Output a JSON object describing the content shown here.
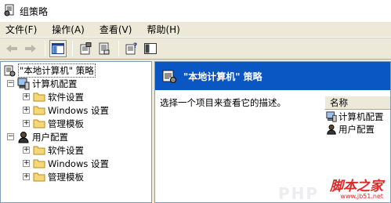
{
  "window": {
    "title": "组策略"
  },
  "menu": [
    {
      "label": "文件(F)"
    },
    {
      "label": "操作(A)"
    },
    {
      "label": "查看(V)"
    },
    {
      "label": "帮助(H)"
    }
  ],
  "toolbar": {
    "buttons": [
      "back-arrow-icon",
      "forward-arrow-icon",
      "show-hide-tree-icon",
      "properties-icon",
      "export-list-icon",
      "help-icon",
      "show-pane-icon"
    ]
  },
  "tree": {
    "root": "\"本地计算机\" 策略",
    "computer": {
      "label": "计算机配置",
      "children": [
        "软件设置",
        "Windows 设置",
        "管理模板"
      ]
    },
    "user": {
      "label": "用户配置",
      "children": [
        "软件设置",
        "Windows 设置",
        "管理模板"
      ]
    }
  },
  "details": {
    "header": "\"本地计算机\" 策略",
    "description": "选择一个项目来查看它的描述。",
    "column": "名称",
    "items": [
      "计算机配置",
      "用户配置"
    ]
  },
  "watermark": {
    "text": "脚本之家",
    "url": "www.jb51.net",
    "faint": "PHP"
  },
  "colors": {
    "header_blue": "#0a57c4",
    "chrome": "#ece9d8",
    "watermark_red": "#e02828"
  }
}
